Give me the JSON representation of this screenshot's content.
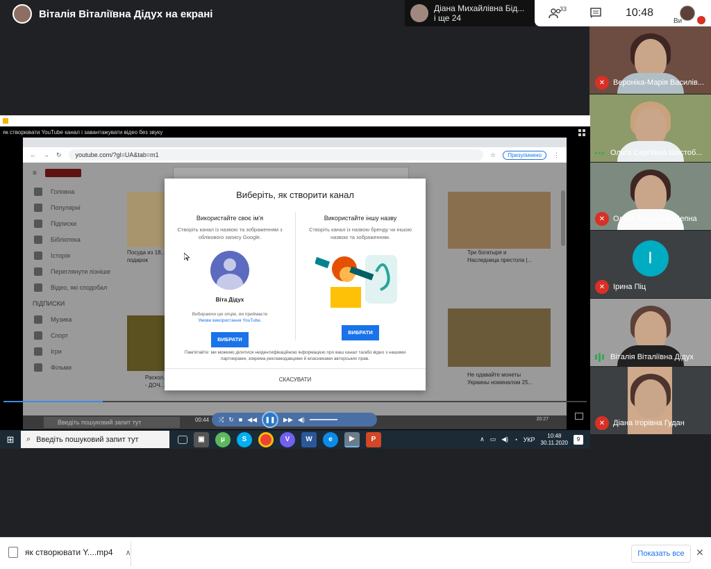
{
  "meet": {
    "presenter_title": "Віталія Віталіївна Дідух на екрані",
    "presenter_chip": {
      "name": "Діана Михайлівна Бід...",
      "more": "і ще 24"
    },
    "participant_count": "33",
    "time": "10:48",
    "self_label": "Ви"
  },
  "participants": [
    {
      "name": "Вероніка-Марія Василів...",
      "muted": true
    },
    {
      "name": "Ольга Сергіївна Шестоб...",
      "muted": false
    },
    {
      "name": "Ольга Андріївна Щепна",
      "muted": true
    },
    {
      "name": "Ірина Піц",
      "muted": true,
      "initial": "І"
    },
    {
      "name": "Віталія Віталіївна Дідух",
      "muted": false,
      "speaking": true
    },
    {
      "name": "Діана Ігорівна Гудан",
      "muted": true
    }
  ],
  "shared": {
    "player_caption": "як створювати YouTube канал і завантажувати відео без звуку",
    "url": "youtube.com/?gl=UA&tab=m1",
    "paused_label": "Призупинено",
    "playback_time": "00:44",
    "progress": 0.17,
    "inner_search": "Введіть пошуковий запит тут",
    "inner_clock_time": "20:27",
    "yt_sidebar": [
      "Головна",
      "Популярні",
      "Підписки",
      "Бібліотека",
      "Історія",
      "Переглянути пізніше",
      "Відео, які сподобал"
    ],
    "yt_subs_heading": "ПІДПИСКИ",
    "yt_subs": [
      "Музика",
      "Спорт",
      "Ігри",
      "Фільми"
    ],
    "yt_thumb_captions": [
      "Посуда из 18...\nподарок",
      "Три богатыря и\nНаследница престола |...",
      "Раскол...\n- ДОЧ...",
      "Не одавайте монеты\nУкраины номиналом 25..."
    ]
  },
  "dialog": {
    "title": "Виберіть, як створити канал",
    "left": {
      "heading": "Використайте своє ім'я",
      "subtitle": "Створіть канал із назвою та зображенням з облікового запису Google.",
      "account_name": "Віта Дідух",
      "note": "Вибираючи цю опцію, ви приймаєте",
      "link": "Умови використання YouTube.",
      "button": "ВИБРАТИ"
    },
    "right": {
      "heading": "Використайте іншу назву",
      "subtitle": "Створіть канал із назвою бренду чи іншою назвою та зображенням.",
      "button": "ВИБРАТИ"
    },
    "footer": "Пам'ятайте: ми можемо ділитися неідентифікаційною інформацією про ваш канал та/або відео з нашими партнерами, зокрема рекламодавцями й власниками авторських прав.",
    "cancel": "СКАСУВАТИ"
  },
  "taskbar": {
    "search_placeholder": "Введіть пошуковий запит тут",
    "lang": "УКР",
    "clock_time": "10:48",
    "clock_date": "30.11.2020",
    "notifications": "9"
  },
  "downloads": {
    "file_name": "як створювати Y....mp4",
    "show_all": "Показать все"
  },
  "colors": {
    "meet_bg": "#202124",
    "mic_off": "#d93025",
    "accent_blue": "#1a73e8"
  }
}
